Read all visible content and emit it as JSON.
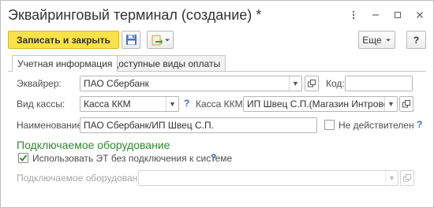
{
  "window": {
    "title": "Эквайринговый терминал (создание) *",
    "controls": [
      "more-vertical-icon",
      "minimize-icon",
      "maximize-icon",
      "close-icon"
    ]
  },
  "toolbar": {
    "save_close_label": "Записать и закрыть",
    "save_icon": "floppy-disk-icon",
    "post_icon": "document-arrow-icon",
    "more_label": "Еще",
    "help_label": "?"
  },
  "tabs": [
    {
      "label": "Учетная информация",
      "active": true
    },
    {
      "label": "Доступные виды оплаты",
      "active": false
    }
  ],
  "form": {
    "acquirer_label": "Эквайрер:",
    "acquirer_value": "ПАО Сбербанк",
    "code_label": "Код:",
    "code_value": "",
    "register_type_label": "Вид кассы:",
    "register_type_value": "Касса ККМ",
    "register_kkm_label": "Касса ККМ:",
    "register_kkm_value": "ИП Швец С.П.(Магазин Интроверт)",
    "name_label": "Наименование:",
    "name_value": "ПАО Сбербанк/ИП Швец С.П.",
    "invalid_label": "Не действителен",
    "invalid_checked": false,
    "help_mark": "?"
  },
  "equipment": {
    "section_title": "Подключаемое оборудование",
    "use_without_connection_label": "Использовать ЭТ без подключения к системе",
    "use_without_connection_checked": true,
    "equipment_label": "Подключаемое оборудование:",
    "equipment_value": ""
  },
  "colors": {
    "primary_button": "#fbe24a",
    "section_title": "#2e8b2e",
    "help_mark": "#3a6fc4"
  }
}
